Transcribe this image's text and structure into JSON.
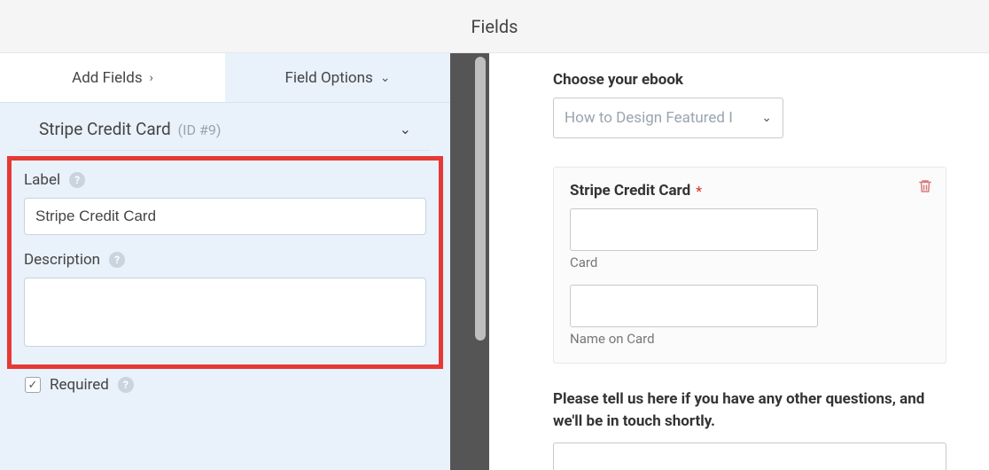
{
  "topbar": {
    "title": "Fields"
  },
  "tabs": {
    "add": "Add Fields",
    "options": "Field Options"
  },
  "field": {
    "title": "Stripe Credit Card",
    "id": "(ID #9)"
  },
  "labels": {
    "label": "Label",
    "description": "Description",
    "required": "Required"
  },
  "values": {
    "label_input": "Stripe Credit Card",
    "description_input": "",
    "required_checked": true
  },
  "preview": {
    "ebook_heading": "Choose your ebook",
    "ebook_selected": "How to Design Featured I",
    "cc_label": "Stripe Credit Card",
    "card_sub": "Card",
    "name_sub": "Name on Card",
    "question": "Please tell us here if you have any other questions, and we'll be in touch shortly."
  }
}
